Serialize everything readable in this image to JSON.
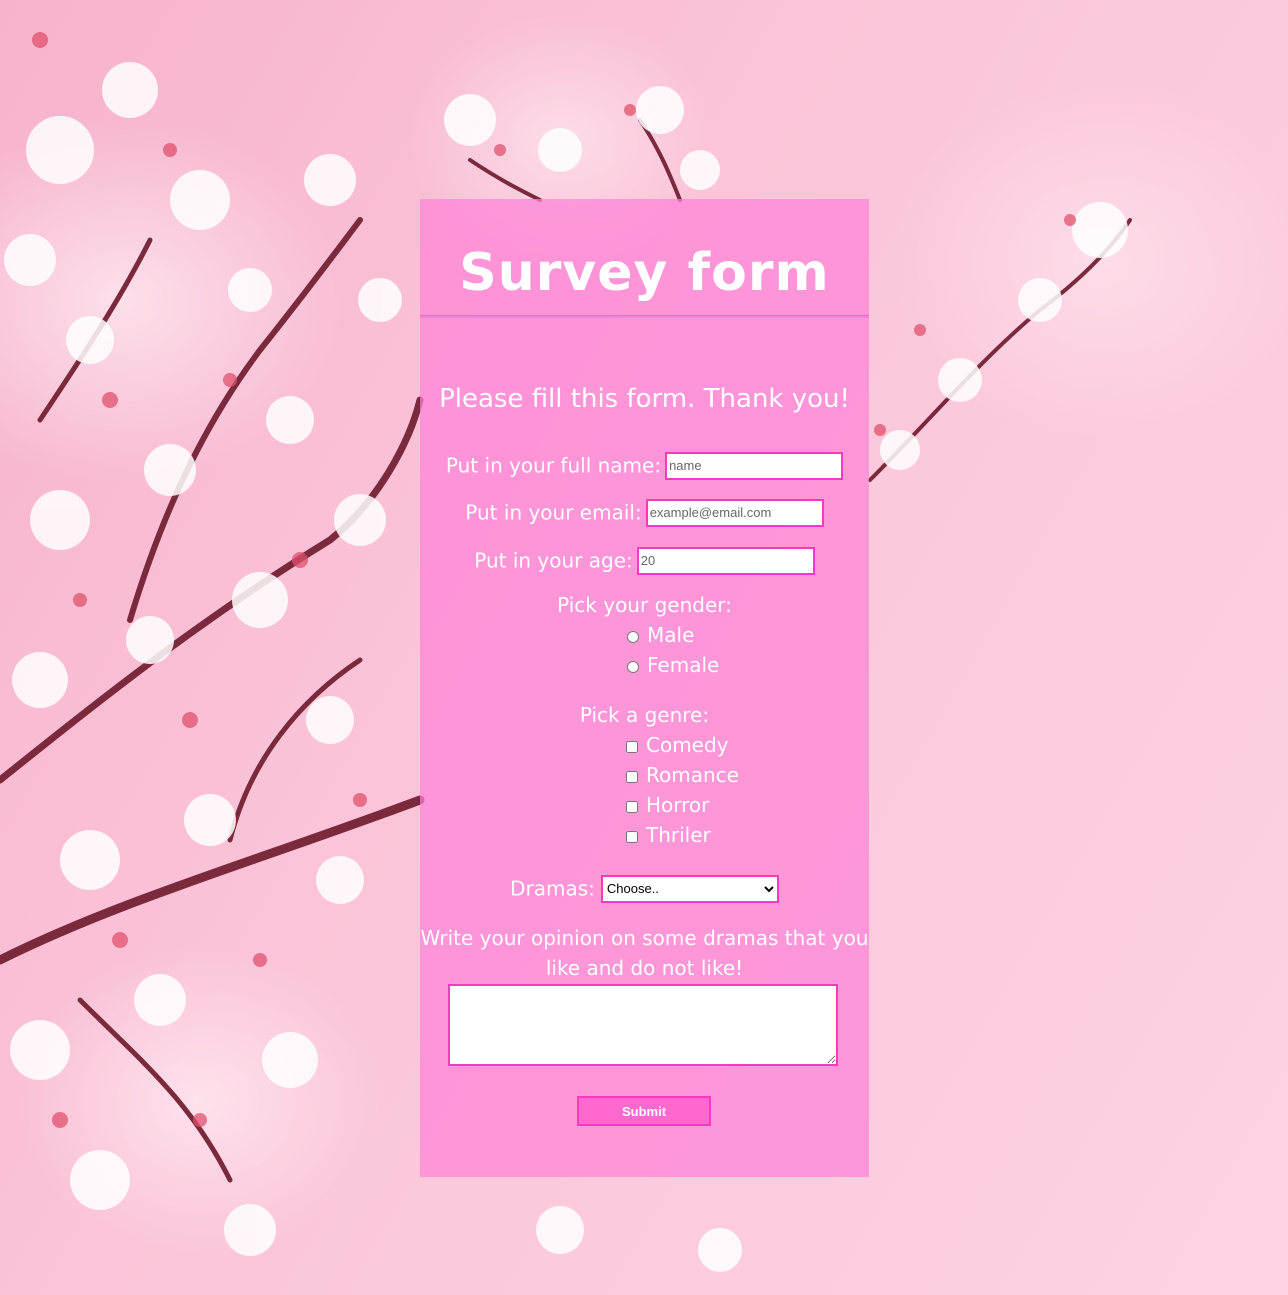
{
  "page": {
    "title": "Survey form",
    "subtitle": "Please fill this form. Thank you!"
  },
  "form": {
    "name": {
      "label": "Put in your full name:",
      "placeholder": "name",
      "value": ""
    },
    "email": {
      "label": "Put in your email:",
      "placeholder": "example@email.com",
      "value": ""
    },
    "age": {
      "label": "Put in your age:",
      "placeholder": "20",
      "value": ""
    },
    "gender": {
      "label": "Pick your gender:",
      "options": [
        "Male",
        "Female"
      ]
    },
    "genre": {
      "label": "Pick a genre:",
      "options": [
        "Comedy",
        "Romance",
        "Horror",
        "Thriler"
      ]
    },
    "dramas": {
      "label": "Dramas:",
      "selected": "Choose.."
    },
    "opinion": {
      "label": "Write your opinion on some dramas that you like and do not like!",
      "value": ""
    },
    "submit_label": "Submit"
  },
  "colors": {
    "card": "#ff82d7",
    "border": "#f63ac0",
    "button": "#ff69cf"
  }
}
